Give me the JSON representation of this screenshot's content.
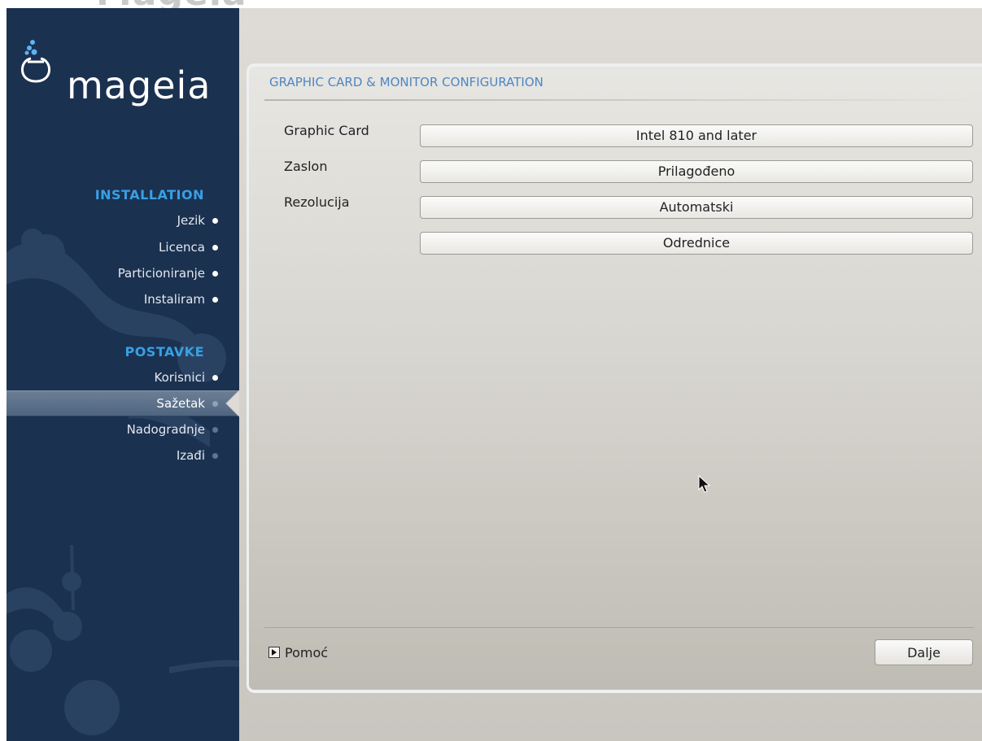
{
  "header_strip": {
    "text": "Mageia"
  },
  "sidebar": {
    "logo_text": "mageia",
    "sections": [
      {
        "heading": "INSTALLATION",
        "items": [
          {
            "label": "Jezik",
            "state": "done"
          },
          {
            "label": "Licenca",
            "state": "done"
          },
          {
            "label": "Particioniranje",
            "state": "done"
          },
          {
            "label": "Instaliram",
            "state": "done"
          }
        ]
      },
      {
        "heading": "POSTAVKE",
        "items": [
          {
            "label": "Korisnici",
            "state": "done"
          },
          {
            "label": "Sažetak",
            "state": "current"
          },
          {
            "label": "Nadogradnje",
            "state": "pending"
          },
          {
            "label": "Izađi",
            "state": "pending"
          }
        ]
      }
    ]
  },
  "panel": {
    "title": "GRAPHIC CARD & MONITOR CONFIGURATION",
    "rows": [
      {
        "label": "Graphic Card",
        "value": "Intel 810 and later"
      },
      {
        "label": "Zaslon",
        "value": "Prilagođeno"
      },
      {
        "label": "Rezolucija",
        "value": "Automatski"
      },
      {
        "label": "",
        "value": "Odrednice"
      }
    ],
    "help_label": "Pomoć",
    "next_label": "Dalje"
  },
  "colors": {
    "sidebar_bg": "#1b3150",
    "section_heading": "#37a0e5",
    "panel_title": "#4e86c4",
    "panel_bg": "#dedbd6"
  },
  "icons": {
    "logo": "mageia-logo-icon",
    "nav_dot": "status-dot-icon",
    "selected_arrow": "selection-arrow-icon",
    "help_toggle": "expander-triangle-icon",
    "cursor": "mouse-pointer-icon"
  }
}
